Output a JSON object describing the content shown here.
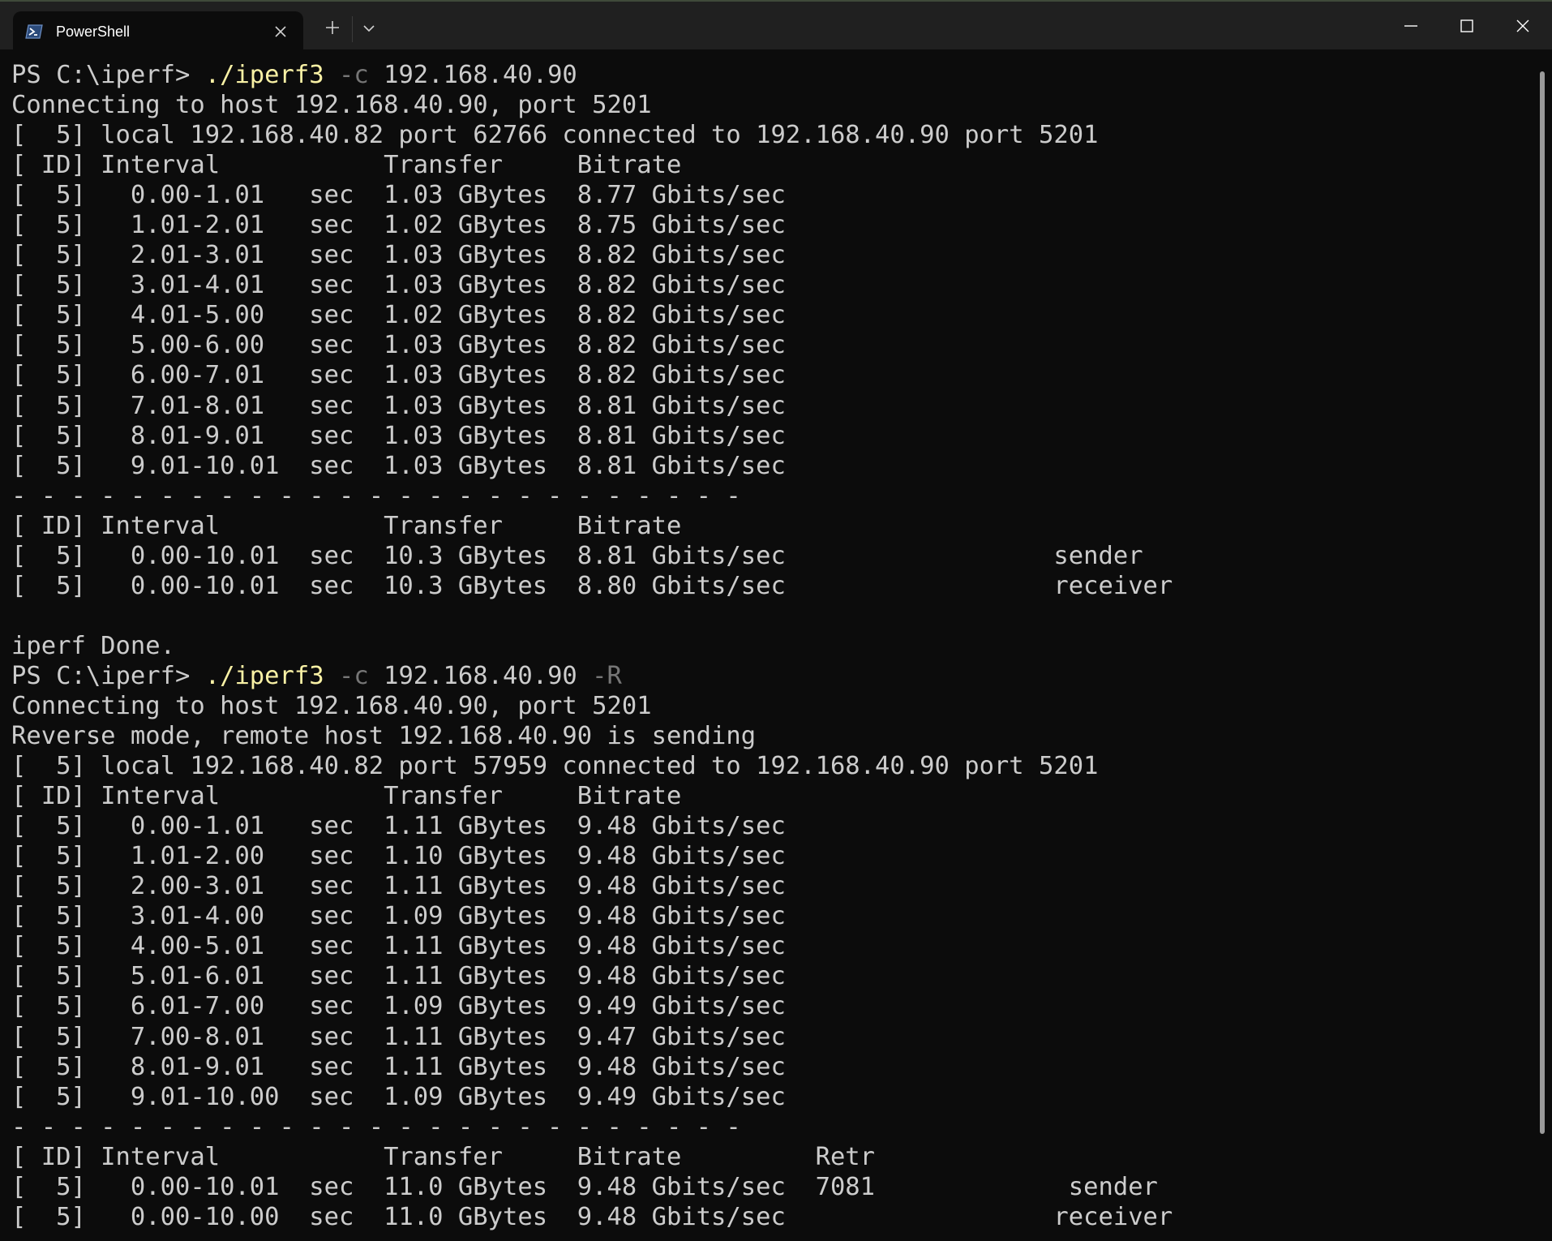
{
  "window": {
    "tab_title": "PowerShell",
    "new_tab_label": "+",
    "colors": {
      "background": "#0c0c0c",
      "titlebar": "#202020",
      "text": "#cccccc",
      "command": "#f9f1a5",
      "parameter": "#767676"
    },
    "icons": [
      "powershell-icon",
      "close-tab-icon",
      "plus-icon",
      "chevron-down-icon",
      "minimize-icon",
      "maximize-icon",
      "close-icon"
    ]
  },
  "terminal": {
    "lines": [
      {
        "prompt": "PS C:\\iperf> ",
        "cmd": "./iperf3",
        "param1": " -c",
        "arg1": " 192.168.40.90",
        "param2": ""
      },
      {
        "text": "Connecting to host 192.168.40.90, port 5201"
      },
      {
        "text": "[  5] local 192.168.40.82 port 62766 connected to 192.168.40.90 port 5201"
      },
      {
        "text": "[ ID] Interval           Transfer     Bitrate"
      },
      {
        "text": "[  5]   0.00-1.01   sec  1.03 GBytes  8.77 Gbits/sec"
      },
      {
        "text": "[  5]   1.01-2.01   sec  1.02 GBytes  8.75 Gbits/sec"
      },
      {
        "text": "[  5]   2.01-3.01   sec  1.03 GBytes  8.82 Gbits/sec"
      },
      {
        "text": "[  5]   3.01-4.01   sec  1.03 GBytes  8.82 Gbits/sec"
      },
      {
        "text": "[  5]   4.01-5.00   sec  1.02 GBytes  8.82 Gbits/sec"
      },
      {
        "text": "[  5]   5.00-6.00   sec  1.03 GBytes  8.82 Gbits/sec"
      },
      {
        "text": "[  5]   6.00-7.01   sec  1.03 GBytes  8.82 Gbits/sec"
      },
      {
        "text": "[  5]   7.01-8.01   sec  1.03 GBytes  8.81 Gbits/sec"
      },
      {
        "text": "[  5]   8.01-9.01   sec  1.03 GBytes  8.81 Gbits/sec"
      },
      {
        "text": "[  5]   9.01-10.01  sec  1.03 GBytes  8.81 Gbits/sec"
      },
      {
        "text": "- - - - - - - - - - - - - - - - - - - - - - - - -"
      },
      {
        "text": "[ ID] Interval           Transfer     Bitrate"
      },
      {
        "text": "[  5]   0.00-10.01  sec  10.3 GBytes  8.81 Gbits/sec                  sender"
      },
      {
        "text": "[  5]   0.00-10.01  sec  10.3 GBytes  8.80 Gbits/sec                  receiver"
      },
      {
        "text": ""
      },
      {
        "text": "iperf Done."
      },
      {
        "prompt": "PS C:\\iperf> ",
        "cmd": "./iperf3",
        "param1": " -c",
        "arg1": " 192.168.40.90",
        "param2": " -R"
      },
      {
        "text": "Connecting to host 192.168.40.90, port 5201"
      },
      {
        "text": "Reverse mode, remote host 192.168.40.90 is sending"
      },
      {
        "text": "[  5] local 192.168.40.82 port 57959 connected to 192.168.40.90 port 5201"
      },
      {
        "text": "[ ID] Interval           Transfer     Bitrate"
      },
      {
        "text": "[  5]   0.00-1.01   sec  1.11 GBytes  9.48 Gbits/sec"
      },
      {
        "text": "[  5]   1.01-2.00   sec  1.10 GBytes  9.48 Gbits/sec"
      },
      {
        "text": "[  5]   2.00-3.01   sec  1.11 GBytes  9.48 Gbits/sec"
      },
      {
        "text": "[  5]   3.01-4.00   sec  1.09 GBytes  9.48 Gbits/sec"
      },
      {
        "text": "[  5]   4.00-5.01   sec  1.11 GBytes  9.48 Gbits/sec"
      },
      {
        "text": "[  5]   5.01-6.01   sec  1.11 GBytes  9.48 Gbits/sec"
      },
      {
        "text": "[  5]   6.01-7.00   sec  1.09 GBytes  9.49 Gbits/sec"
      },
      {
        "text": "[  5]   7.00-8.01   sec  1.11 GBytes  9.47 Gbits/sec"
      },
      {
        "text": "[  5]   8.01-9.01   sec  1.11 GBytes  9.48 Gbits/sec"
      },
      {
        "text": "[  5]   9.01-10.00  sec  1.09 GBytes  9.49 Gbits/sec"
      },
      {
        "text": "- - - - - - - - - - - - - - - - - - - - - - - - -"
      },
      {
        "text": "[ ID] Interval           Transfer     Bitrate         Retr"
      },
      {
        "text": "[  5]   0.00-10.01  sec  11.0 GBytes  9.48 Gbits/sec  7081             sender"
      },
      {
        "text": "[  5]   0.00-10.00  sec  11.0 GBytes  9.48 Gbits/sec                  receiver"
      }
    ]
  }
}
